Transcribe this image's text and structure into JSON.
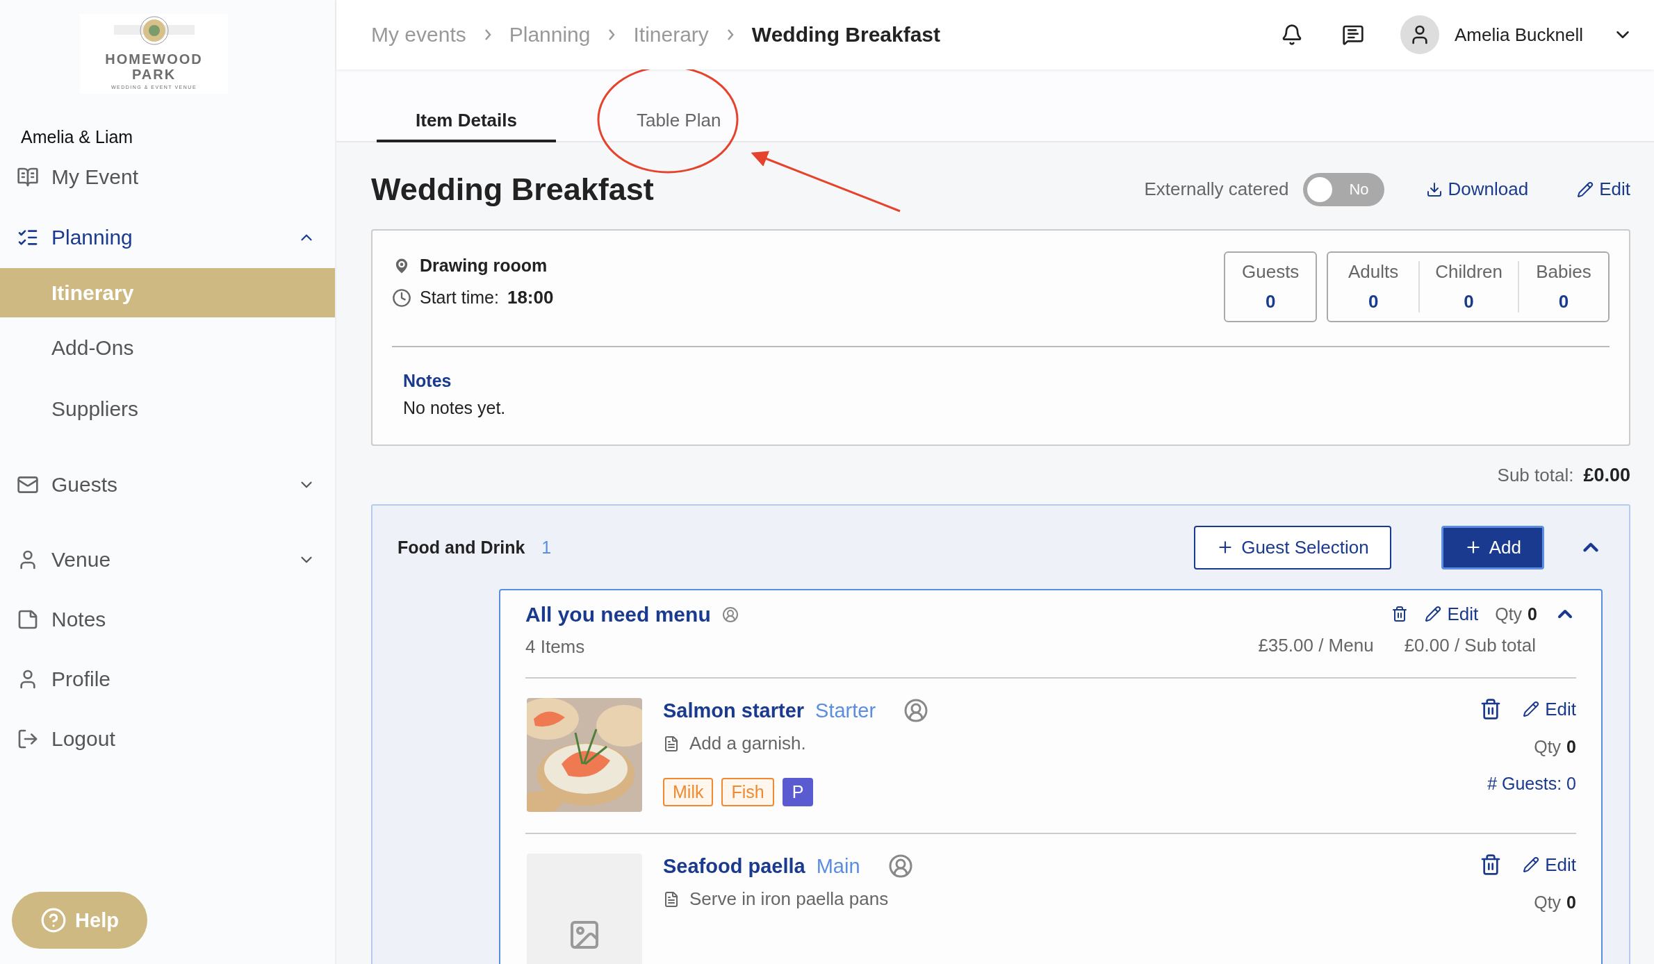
{
  "logo": {
    "line_1": "HOMEWOOD",
    "line_2": "PARK",
    "tagline": "WEDDING & EVENT VENUE"
  },
  "event_name": "Amelia & Liam",
  "nav": [
    {
      "label": "My Event",
      "kind": "item"
    },
    {
      "label": "Planning",
      "kind": "group",
      "expanded": true,
      "children": [
        {
          "label": "Itinerary",
          "selected": true
        },
        {
          "label": "Add-Ons",
          "selected": false
        },
        {
          "label": "Suppliers",
          "selected": false
        }
      ]
    },
    {
      "label": "Guests",
      "kind": "group",
      "expanded": false
    },
    {
      "label": "Venue",
      "kind": "group",
      "expanded": false
    },
    {
      "label": "Notes",
      "kind": "item"
    },
    {
      "label": "Profile",
      "kind": "item"
    },
    {
      "label": "Logout",
      "kind": "item"
    }
  ],
  "help": "Help",
  "breadcrumbs": [
    "My events",
    "Planning",
    "Itinerary",
    "Wedding Breakfast"
  ],
  "user": {
    "name": "Amelia Bucknell"
  },
  "tabs": [
    {
      "label": "Item Details",
      "selected": true
    },
    {
      "label": "Table Plan",
      "selected": false
    }
  ],
  "title": "Wedding Breakfast",
  "catering": {
    "label": "Externally catered",
    "on": false,
    "state_label": "No"
  },
  "actions": [
    "Download",
    "Edit"
  ],
  "details": {
    "location": "Drawing rooom",
    "start_label": "Start time:",
    "start_time": "18:00",
    "count_groups": [
      {
        "items": [
          {
            "label": "Guests",
            "value": "0"
          }
        ]
      },
      {
        "items": [
          {
            "label": "Adults",
            "value": "0"
          },
          {
            "label": "Children",
            "value": "0"
          },
          {
            "label": "Babies",
            "value": "0"
          }
        ]
      }
    ],
    "notes_heading": "Notes",
    "notes": "No notes yet."
  },
  "subtotal": {
    "label": "Sub total:",
    "value": "£0.00"
  },
  "section": {
    "title": "Food and Drink",
    "count": "1",
    "expanded": true,
    "guest_selection": "Guest Selection",
    "add": "Add",
    "menu": {
      "name": "All you need menu",
      "items_count": "4 Items",
      "edit": "Edit",
      "qty_label": "Qty",
      "qty": "0",
      "price": "£35.00 / Menu",
      "subtotal": "£0.00 / Sub total",
      "expanded": true,
      "items": [
        {
          "name": "Salmon starter",
          "course": "Starter",
          "note": "Add a garnish.",
          "kind": "picture",
          "edit": "Edit",
          "qty_label": "Qty",
          "qty": "0",
          "guests": "# Guests: 0",
          "tags": [
            {
              "label": "Milk",
              "kind": "outline",
              "color": "#f0892f"
            },
            {
              "label": "Fish",
              "kind": "outline",
              "color": "#f0892f"
            },
            {
              "label": "P",
              "kind": "filled",
              "color": "#5a5bd0"
            }
          ]
        },
        {
          "name": "Seafood paella",
          "course": "Main",
          "note": "Serve in iron paella pans",
          "kind": "placeholder",
          "edit": "Edit",
          "qty_label": "Qty",
          "qty": "0"
        }
      ]
    }
  }
}
